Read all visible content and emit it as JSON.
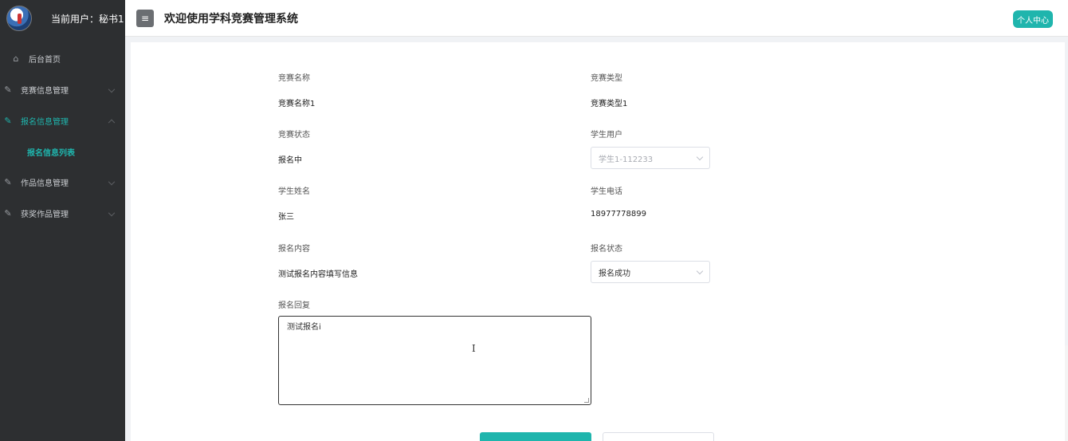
{
  "sidebar": {
    "user_label": "当前用户：",
    "user_name": "秘书1",
    "items": [
      {
        "label": "后台首页",
        "icon": "home-icon"
      },
      {
        "label": "竞赛信息管理",
        "icon": "edit-icon"
      },
      {
        "label": "报名信息管理",
        "icon": "edit-icon",
        "active": true
      },
      {
        "label": "报名信息列表"
      },
      {
        "label": "作品信息管理",
        "icon": "edit-icon"
      },
      {
        "label": "获奖作品管理",
        "icon": "edit-icon"
      }
    ]
  },
  "header": {
    "title": "欢迎使用学科竞赛管理系统",
    "profile_button": "个人中心"
  },
  "form": {
    "competition_name": {
      "label": "竞赛名称",
      "value": "竞赛名称1"
    },
    "competition_type": {
      "label": "竞赛类型",
      "value": "竞赛类型1"
    },
    "competition_status": {
      "label": "竞赛状态",
      "value": "报名中"
    },
    "student_user": {
      "label": "学生用户",
      "value": "学生1-112233"
    },
    "student_name": {
      "label": "学生姓名",
      "value": "张三"
    },
    "student_phone": {
      "label": "学生电话",
      "value": "18977778899"
    },
    "signup_content": {
      "label": "报名内容",
      "value": "测试报名内容填写信息"
    },
    "signup_status": {
      "label": "报名状态",
      "value": "报名成功"
    },
    "signup_reply": {
      "label": "报名回复",
      "value": "测试报名i"
    }
  },
  "colors": {
    "accent": "#1fb5ad",
    "sidebar_bg": "#2d2f31"
  }
}
